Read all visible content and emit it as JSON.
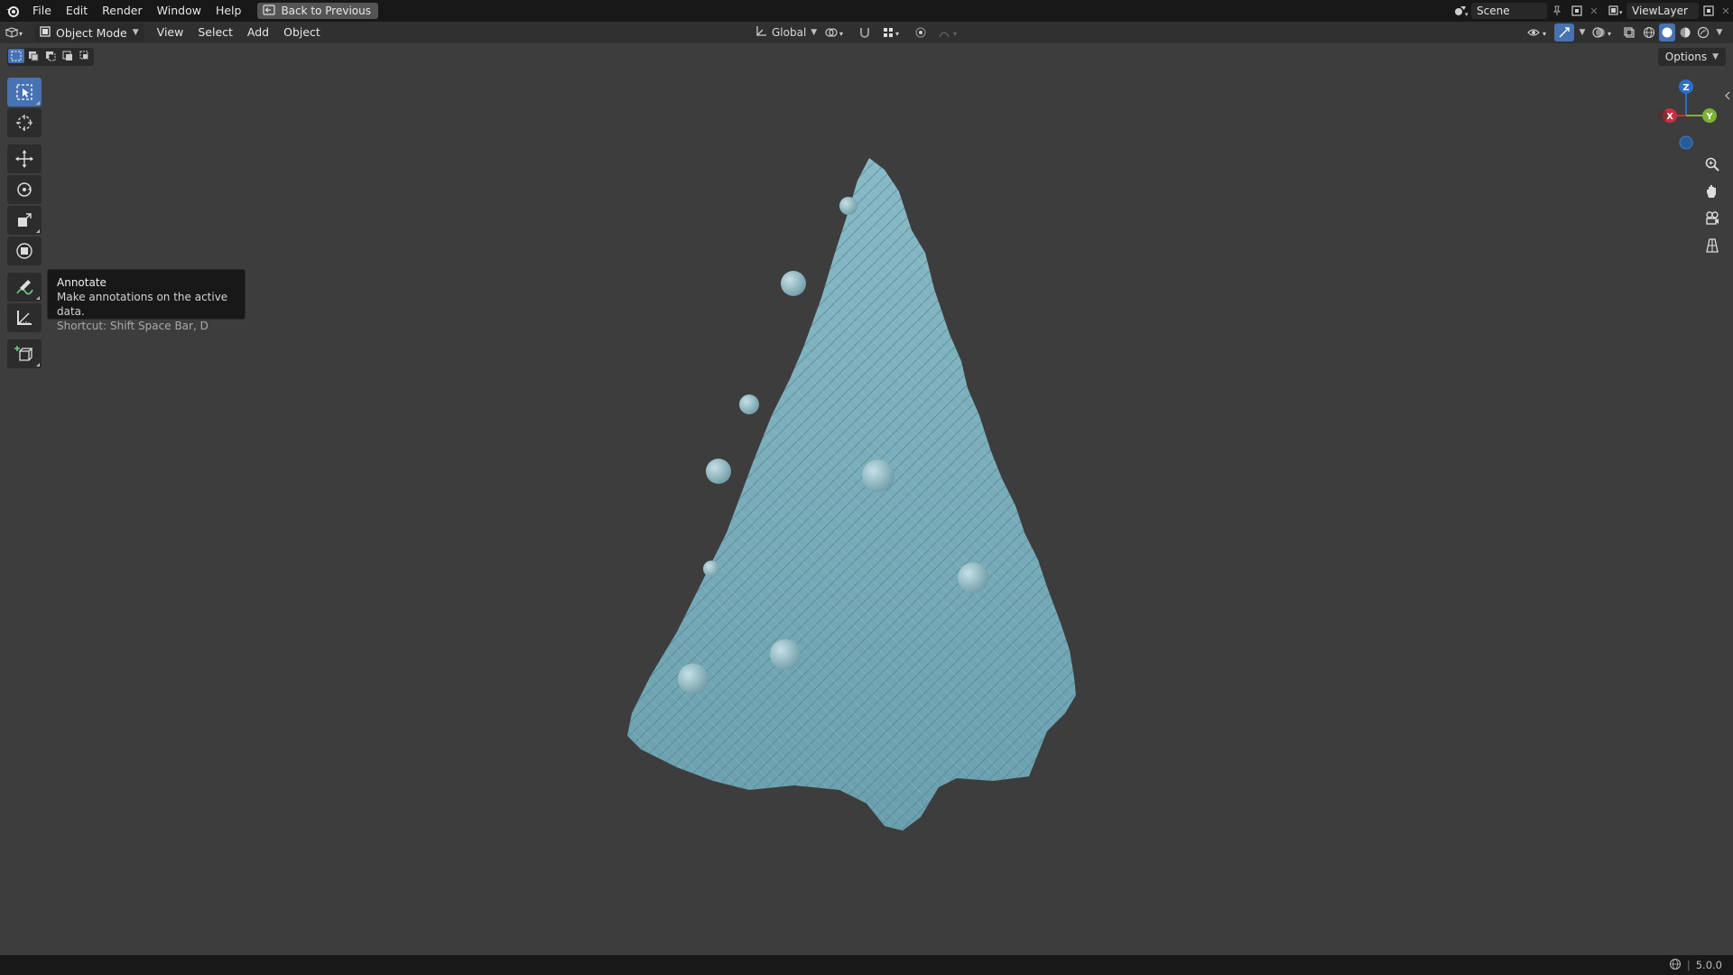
{
  "menubar": {
    "items": [
      "File",
      "Edit",
      "Render",
      "Window",
      "Help"
    ],
    "back_button": "Back to Previous",
    "scene_label": "Scene",
    "viewlayer_label": "ViewLayer"
  },
  "header": {
    "mode": "Object Mode",
    "menus": [
      "View",
      "Select",
      "Add",
      "Object"
    ],
    "transform_orientation": "Global"
  },
  "viewport": {
    "options_label": "Options",
    "gizmo_axes": {
      "x": "X",
      "y": "Y",
      "z": "Z"
    }
  },
  "toolbar": {
    "tools": [
      "select-box-tool",
      "cursor-tool",
      "move-tool",
      "rotate-tool",
      "scale-tool",
      "transform-tool",
      "annotate-tool",
      "measure-tool",
      "add-cube-tool"
    ],
    "active_tool": "select-box-tool"
  },
  "tooltip": {
    "title": "Annotate",
    "description": "Make annotations on the active data.",
    "shortcut": "Shortcut: Shift Space Bar, D"
  },
  "statusbar": {
    "version": "5.0.0"
  },
  "colors": {
    "accent": "#4772b3",
    "tree": "#7fb3c0",
    "background": "#3d3d3d"
  }
}
